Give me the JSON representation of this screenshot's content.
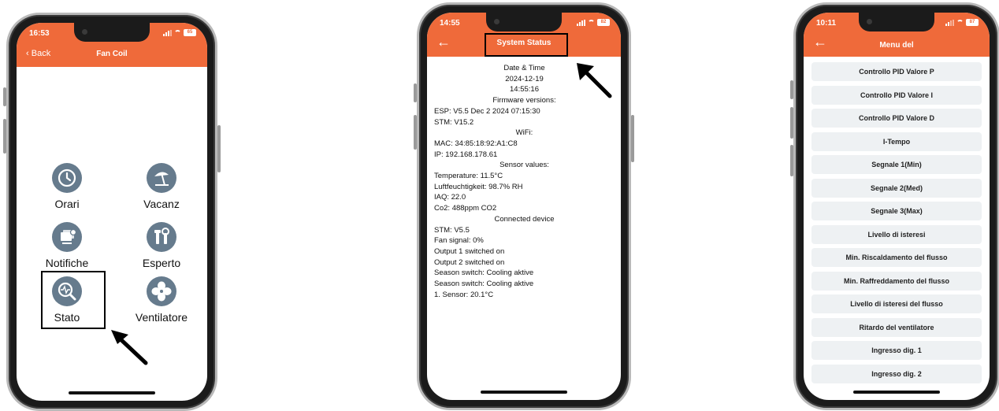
{
  "phone1": {
    "time": "16:53",
    "back": "Back",
    "title": "Fan Coil",
    "battery": "65",
    "items": [
      {
        "label": "Orari",
        "icon": "clock-icon"
      },
      {
        "label": "Vacanz",
        "icon": "beach-umbrella-icon"
      },
      {
        "label": "Notifiche",
        "icon": "notification-icon"
      },
      {
        "label": "Esperto",
        "icon": "tools-icon"
      },
      {
        "label": "Stato",
        "icon": "magnifier-status-icon"
      },
      {
        "label": "Ventilatore",
        "icon": "fan-icon"
      }
    ]
  },
  "phone2": {
    "time": "14:55",
    "title": "System Status",
    "battery": "82",
    "lines": [
      {
        "text": "Date & Time",
        "center": true
      },
      {
        "text": "2024-12-19",
        "center": true
      },
      {
        "text": "14:55:16",
        "center": true
      },
      {
        "text": "Firmware versions:",
        "center": true
      },
      {
        "text": "ESP: V5.5 Dec 2 2024 07:15:30",
        "center": false
      },
      {
        "text": "STM: V15.2",
        "center": false
      },
      {
        "text": "WiFi:",
        "center": true
      },
      {
        "text": "MAC: 34:85:18:92:A1:C8",
        "center": false
      },
      {
        "text": "IP: 192.168.178.61",
        "center": false
      },
      {
        "text": "Sensor values:",
        "center": true
      },
      {
        "text": "Temperature: 11.5°C",
        "center": false
      },
      {
        "text": "Luftfeuchtigkeit: 98.7% RH",
        "center": false
      },
      {
        "text": "IAQ: 22.0",
        "center": false
      },
      {
        "text": "Co2: 488ppm CO2",
        "center": false
      },
      {
        "text": "Connected device",
        "center": true
      },
      {
        "text": "STM: V5.5",
        "center": false
      },
      {
        "text": "Fan signal: 0%",
        "center": false
      },
      {
        "text": "Output 1 switched on",
        "center": false
      },
      {
        "text": "Output 2 switched on",
        "center": false
      },
      {
        "text": "Season switch: Cooling aktive",
        "center": false
      },
      {
        "text": "Season switch: Cooling aktive",
        "center": false
      },
      {
        "text": "1. Sensor: 20.1°C",
        "center": false
      }
    ]
  },
  "phone3": {
    "time": "10:11",
    "title": "Menu del",
    "battery": "87",
    "items": [
      "Controllo PID Valore P",
      "Controllo PID Valore I",
      "Controllo PID Valore D",
      "I-Tempo",
      "Segnale 1(Min)",
      "Segnale 2(Med)",
      "Segnale 3(Max)",
      "Livello di isteresi",
      "Min. Riscaldamento del flusso",
      "Min. Raffreddamento del flusso",
      "Livello di isteresi del flusso",
      "Ritardo del ventilatore",
      "Ingresso dig. 1",
      "Ingresso dig. 2"
    ]
  },
  "colors": {
    "accent": "#ef6a3a",
    "icon_circle": "#667b8d",
    "menu_item_bg": "#eef1f3"
  }
}
